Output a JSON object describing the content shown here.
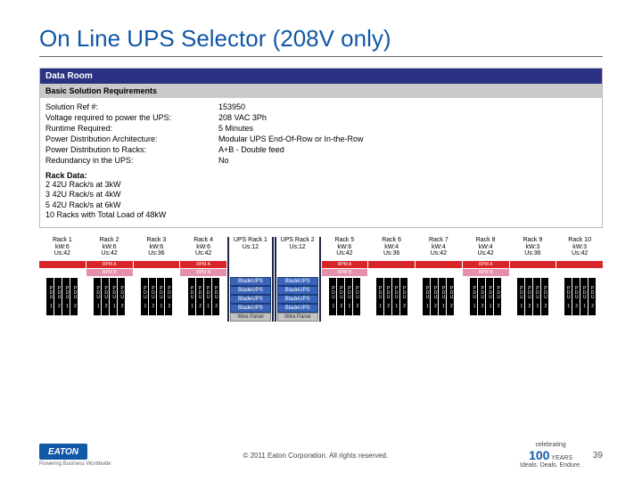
{
  "title": "On Line UPS Selector (208V only)",
  "panel": {
    "header": "Data Room",
    "subheader": "Basic Solution Requirements",
    "rows": [
      {
        "label": "Solution Ref #:",
        "value": "153950"
      },
      {
        "label": "Voltage required to power the UPS:",
        "value": "208 VAC 3Ph"
      },
      {
        "label": "Runtime Required:",
        "value": "5 Minutes"
      },
      {
        "label": "Power Distribution Architecture:",
        "value": "Modular UPS End-Of-Row or In-the-Row"
      },
      {
        "label": "Power Distribution to Racks:",
        "value": "A+B - Double feed"
      },
      {
        "label": "Redundancy in the UPS:",
        "value": "No"
      }
    ],
    "rackHeader": "Rack Data:",
    "rackLines": [
      "2    42U Rack/s at 3kW",
      "3    42U Rack/s at 4kW",
      "5    42U Rack/s at 6kW",
      "10 Racks with Total Load of 48kW"
    ]
  },
  "diagram": {
    "columns": [
      {
        "name": "Rack 1",
        "l2": "kW:6",
        "l3": "Us:42",
        "busA": "red",
        "busB": "blank",
        "pdus": [
          "PDU 1",
          "PDU 2",
          "PDU 1",
          "PDU 2"
        ]
      },
      {
        "name": "Rack 2",
        "l2": "kW:6",
        "l3": "Us:42",
        "busA": "red",
        "busB": "pink",
        "pdus": [
          "PDU 1",
          "PDU 2",
          "PDU 1",
          "PDU 2"
        ],
        "busLabelA": "RPM A",
        "busLabelB": "RPM B"
      },
      {
        "name": "Rack 3",
        "l2": "kW:6",
        "l3": "Us:36",
        "busA": "red",
        "busB": "blank",
        "pdus": [
          "PDU 1",
          "PDU 2",
          "PDU 1",
          "PDU 2"
        ]
      },
      {
        "name": "Rack 4",
        "l2": "kW:6",
        "l3": "Us:42",
        "busA": "red",
        "busB": "pink",
        "pdus": [
          "PDU 1",
          "PDU 2",
          "PDU 1",
          "PDU 2"
        ],
        "busLabelA": "RPM A",
        "busLabelB": "RPM B"
      },
      {
        "name": "UPS Rack 1",
        "l2": "Us:12",
        "l3": "",
        "busA": "blank",
        "busB": "blank",
        "ups": true
      },
      {
        "name": "UPS Rack 2",
        "l2": "Us:12",
        "l3": "",
        "busA": "blank",
        "busB": "blank",
        "ups": true
      },
      {
        "name": "Rack 5",
        "l2": "kW:6",
        "l3": "Us:42",
        "busA": "red",
        "busB": "pink",
        "pdus": [
          "PDU 1",
          "PDU 2",
          "PDU 1",
          "PDU 2"
        ],
        "busLabelA": "RPM A",
        "busLabelB": "RPM B"
      },
      {
        "name": "Rack 6",
        "l2": "kW:4",
        "l3": "Us:36",
        "busA": "red",
        "busB": "blank",
        "pdus": [
          "PDU 1",
          "PDU 2",
          "PDU 1",
          "PDU 2"
        ]
      },
      {
        "name": "Rack 7",
        "l2": "kW:4",
        "l3": "Us:42",
        "busA": "red",
        "busB": "blank",
        "pdus": [
          "PDU 1",
          "PDU 2",
          "PDU 1",
          "PDU 2"
        ]
      },
      {
        "name": "Rack 8",
        "l2": "kW:4",
        "l3": "Us:42",
        "busA": "red",
        "busB": "pink",
        "pdus": [
          "PDU 1",
          "PDU 2",
          "PDU 1",
          "PDU 2"
        ],
        "busLabelA": "RPM A",
        "busLabelB": "RPM B"
      },
      {
        "name": "Rack 9",
        "l2": "kW:3",
        "l3": "Us:36",
        "busA": "red",
        "busB": "blank",
        "pdus": [
          "PDU 1",
          "PDU 2",
          "PDU 1",
          "PDU 2"
        ]
      },
      {
        "name": "Rack 10",
        "l2": "kW:3",
        "l3": "Us:42",
        "busA": "red",
        "busB": "blank",
        "pdus": [
          "PDU 1",
          "PDU 2",
          "PDU 1",
          "PDU 2"
        ]
      }
    ],
    "bladeLabel": "BladeUPS",
    "wireLabel": "Wire Panel",
    "bladeCount": 4
  },
  "footer": {
    "logoText": "EATON",
    "tagline": "Powering Business Worldwide",
    "copyright": "© 2011 Eaton Corporation. All rights reserved.",
    "annivTop": "celebrating",
    "annivNum": "100",
    "annivUnit": "YEARS",
    "annivSub": "Ideals. Deals. Endure.",
    "page": "39"
  }
}
